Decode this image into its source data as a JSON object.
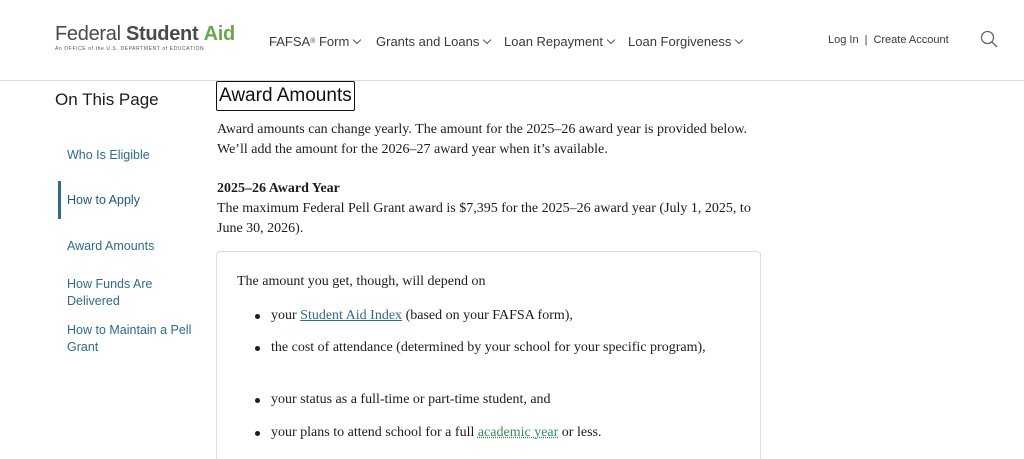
{
  "logo": {
    "fed": "Federal",
    "student": "Student",
    "aid": "Aid",
    "sub": "An OFFICE of the U.S. DEPARTMENT of EDUCATION"
  },
  "nav": {
    "fafsa": "FAFSA",
    "fafsa_sup": "®",
    "fafsa_suffix": "Form",
    "grants": "Grants and Loans",
    "repayment": "Loan Repayment",
    "forgiveness": "Loan Forgiveness"
  },
  "account": {
    "login": "Log In",
    "separator": "|",
    "create": "Create Account"
  },
  "sidebar": {
    "title": "On This Page",
    "items": [
      {
        "label": "Who Is Eligible"
      },
      {
        "label": "How to Apply"
      },
      {
        "label": "Award Amounts"
      },
      {
        "label": "How Funds Are Delivered"
      },
      {
        "label": "How to Maintain a Pell Grant"
      }
    ]
  },
  "main": {
    "heading": "Award Amounts",
    "intro": "Award amounts can change yearly. The amount for the 2025–26 award year is provided below. We’ll add the amount for the 2026–27 award year when it’s available.",
    "year_heading": "2025–26 Award Year",
    "year_text": "The maximum Federal Pell Grant award is $7,395 for the 2025–26 award year (July 1, 2025, to June 30, 2026).",
    "card": {
      "intro": "The amount you get, though, will depend on",
      "b1_pre": "your",
      "b1_link": "Student Aid Index",
      "b1_post": "(based on your FAFSA form),",
      "b2": "the cost of attendance (determined by your school for your specific program),",
      "b3": "your status as a full-time or part-time student, and",
      "b4_pre": "your plans to attend school for a full",
      "b4_link": "academic year",
      "b4_post": "or less."
    }
  },
  "colors": {
    "link": "#2f6b8a",
    "logo_accent": "#6aa84f"
  }
}
